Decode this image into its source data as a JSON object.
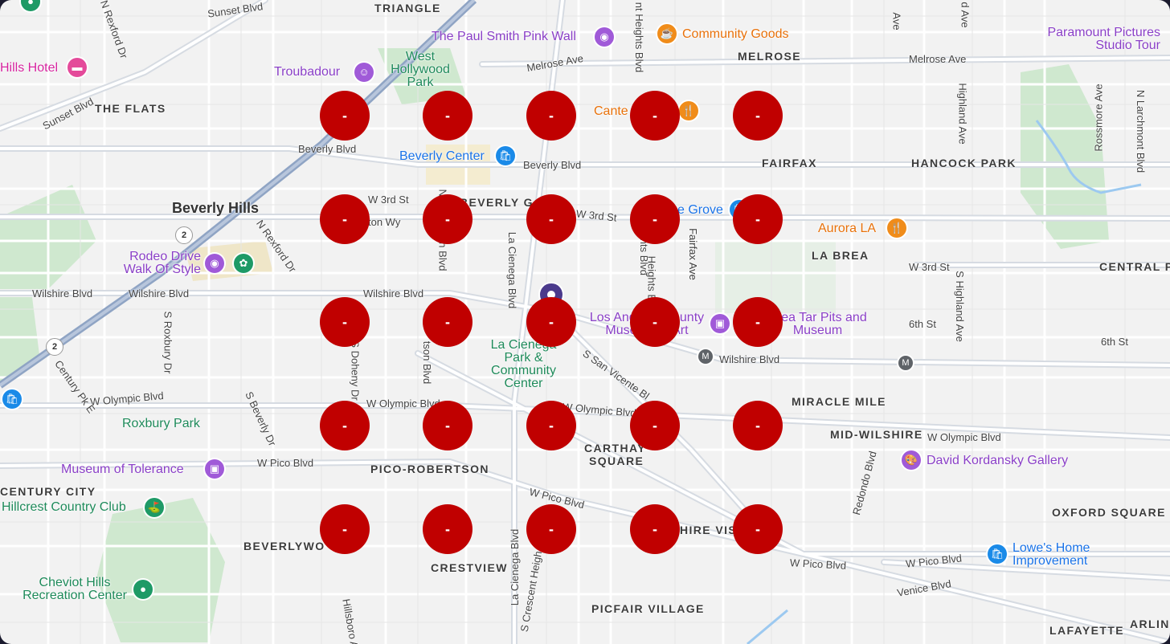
{
  "map": {
    "districts": [
      "TRIANGLE",
      "MELROSE",
      "THE FLATS",
      "FAIRFAX",
      "HANCOCK PARK",
      "LA BREA",
      "CENTRAL P",
      "MIRACLE MILE",
      "MID-WILSHIRE",
      "CARTHAY",
      "SQUARE",
      "PICO-ROBERTSON",
      "CENTURY CITY",
      "OXFORD SQUARE",
      "BEVERLYWO",
      "CRESTVIEW",
      "HIRE VIS",
      "PICFAIR VILLAGE",
      "LAFAYETTE",
      "ARLIN",
      "BEVERLY G"
    ],
    "city": "Beverly Hills",
    "streets": [
      "Sunset Blvd",
      "N Rexford Dr",
      "Melrose Ave",
      "Melrose Ave",
      "Sunset Blvd",
      "Beverly Blvd",
      "Beverly Blvd",
      "W 3rd St",
      "W 3rd St",
      "ton Wy",
      "N Rexford Dr",
      "Wilshire Blvd",
      "Wilshire Blvd",
      "Wilshire Blvd",
      "Wilshire Blvd",
      "W 3rd St",
      "6th St",
      "6th St",
      "W Olympic Blvd",
      "W Olympic Blvd",
      "W Olympic Blvd",
      "W Olympic Blvd",
      "W Pico Blvd",
      "W Pico Blvd",
      "W Pico Blvd",
      "W Pico Blvd",
      "Venice Blvd",
      "Century Pk E",
      "S Roxbury Dr",
      "S Beverly Dr",
      "S Doheny Dr",
      "tson Blvd",
      "La Cienega Blvd",
      "La Cienega Blvd",
      "S San Vicente Bl",
      "Fairfax Ave",
      "S Highland Ave",
      "Highland Ave",
      "Rossmore Ave",
      "N Larchmont Blvd",
      "Redondo Blvd",
      "Hillsboro A",
      "S Crescent Heigh",
      "Heights Blvd",
      "nt Heights Blvd",
      "d Ave",
      "Ave",
      "N Robertson Blvd",
      "Heights Blv",
      "Fairfax Ave"
    ],
    "pois": {
      "paul_smith": "The Paul Smith Pink Wall",
      "community_goods": "Community Goods",
      "paramount": "Paramount Pictures Studio Tour",
      "hills_hotel": "Hills Hotel",
      "troubadour": "Troubadour",
      "west_hollywood_park": "West Hollywood Park",
      "canter": "Cante",
      "beverly_center": "Beverly Center",
      "grove": "e Grove",
      "aurora": "Aurora LA",
      "rodeo": "Rodeo Drive Walk Of Style",
      "lacma": "Los Angeles County Museum of Art",
      "tar_pits": "Brea Tar Pits and Museum",
      "la_cienega_park": "La Cienega Park & Community Center",
      "roxbury_park": "Roxbury Park",
      "museum_tolerance": "Museum of Tolerance",
      "kordansky": "David Kordansky Gallery",
      "hillcrest": "Hillcrest Country Club",
      "lowes": "Lowe's Home Improvement",
      "cheviot": "Cheviot Hills Recreation Center"
    },
    "route_shields": [
      "2",
      "2"
    ],
    "metro_icons": [
      "M",
      "M"
    ]
  },
  "grid": {
    "markers": [
      "-",
      "-",
      "-",
      "-",
      "-",
      "-",
      "-",
      "-",
      "-",
      "-",
      "-",
      "-",
      "-",
      "-",
      "-",
      "-",
      "-",
      "-",
      "-",
      "-",
      "-",
      "-",
      "-",
      "-",
      "-"
    ],
    "marker_color": "#c00000"
  },
  "pin": {
    "color": "#4b3a8c"
  },
  "colors": {
    "background": "#f2f2f2",
    "park": "#c8e6c9",
    "freeway": "#8fa4c4"
  }
}
